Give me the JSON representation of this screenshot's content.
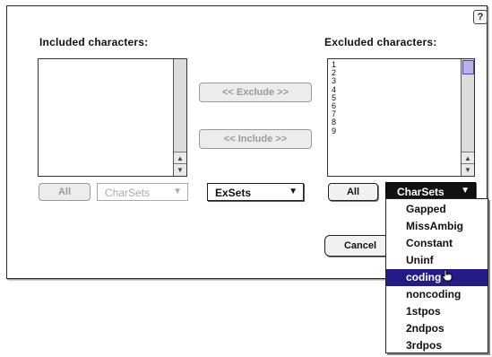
{
  "dialog": {
    "help_icon": "?",
    "included_label": "Included characters:",
    "excluded_label": "Excluded characters:",
    "exclude_button": "<< Exclude >>",
    "include_button": "<< Include >>",
    "included_all_button": "All",
    "included_charsets_popup": "CharSets",
    "exsets_popup": "ExSets",
    "excluded_all_button": "All",
    "excluded_charsets_popup": "CharSets",
    "cancel_button": "Cancel",
    "excluded_items": [
      "1",
      "2",
      "3",
      "4",
      "5",
      "6",
      "7",
      "8",
      "9"
    ]
  },
  "charsets_menu": {
    "items": [
      "Gapped",
      "MissAmbig",
      "Constant",
      "Uninf",
      "coding",
      "noncoding",
      "1stpos",
      "2ndpos",
      "3rdpos"
    ],
    "highlighted": "coding"
  },
  "colors": {
    "menu_highlight": "#231c86",
    "scroll_thumb": "#b9b3ea"
  }
}
